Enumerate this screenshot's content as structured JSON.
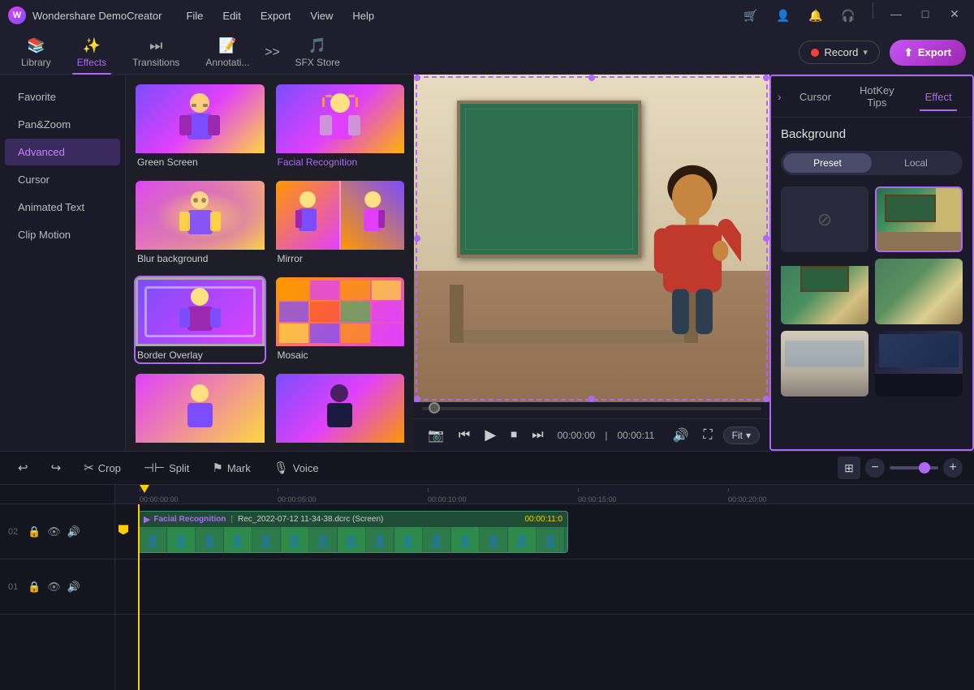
{
  "app": {
    "name": "Wondershare DemoCreator",
    "logo": "W"
  },
  "title_bar": {
    "menu_items": [
      "File",
      "Edit",
      "Export",
      "View",
      "Help"
    ],
    "icons": [
      "cart-icon",
      "user-icon",
      "notification-icon",
      "headset-icon"
    ],
    "win_minimize": "—",
    "win_maximize": "□",
    "win_close": "✕"
  },
  "toolbar": {
    "tabs": [
      {
        "id": "library",
        "label": "Library",
        "icon": "📚"
      },
      {
        "id": "effects",
        "label": "Effects",
        "icon": "✨"
      },
      {
        "id": "transitions",
        "label": "Transitions",
        "icon": "⏭"
      },
      {
        "id": "annotations",
        "label": "Annotati...",
        "icon": "📝"
      },
      {
        "id": "sfx",
        "label": "SFX Store",
        "icon": "🎵"
      }
    ],
    "active_tab": "effects",
    "record_label": "Record",
    "export_label": "Export"
  },
  "sidebar": {
    "items": [
      {
        "id": "favorite",
        "label": "Favorite"
      },
      {
        "id": "panzoom",
        "label": "Pan&Zoom"
      },
      {
        "id": "advanced",
        "label": "Advanced"
      },
      {
        "id": "cursor",
        "label": "Cursor"
      },
      {
        "id": "animated_text",
        "label": "Animated Text"
      },
      {
        "id": "clip_motion",
        "label": "Clip Motion"
      }
    ],
    "active": "advanced"
  },
  "effects": {
    "cards": [
      {
        "id": "green_screen",
        "label": "Green Screen",
        "style": "gc",
        "selected": false
      },
      {
        "id": "facial_recognition",
        "label": "Facial Recognition",
        "style": "fr",
        "selected": true
      },
      {
        "id": "blur_background",
        "label": "Blur background",
        "style": "blur",
        "selected": false
      },
      {
        "id": "mirror",
        "label": "Mirror",
        "style": "mirror",
        "selected": false
      },
      {
        "id": "border_overlay",
        "label": "Border Overlay",
        "style": "border",
        "selected": true
      },
      {
        "id": "mosaic",
        "label": "Mosaic",
        "style": "mosaic",
        "selected": false
      },
      {
        "id": "extra1",
        "label": "",
        "style": "extra1",
        "selected": false
      },
      {
        "id": "extra2",
        "label": "",
        "style": "extra2",
        "selected": false
      }
    ]
  },
  "video": {
    "current_time": "00:00:00",
    "total_time": "00:00:11",
    "fit_label": "Fit"
  },
  "right_panel": {
    "tabs": [
      "Cursor",
      "HotKey Tips",
      "Effect"
    ],
    "active_tab": "Effect",
    "section_title": "Background",
    "preset_btn": "Preset",
    "local_btn": "Local",
    "active_toggle": "Preset",
    "backgrounds": [
      {
        "id": "none",
        "type": "none"
      },
      {
        "id": "classroom1",
        "type": "classroom1"
      },
      {
        "id": "classroom2",
        "type": "classroom2"
      },
      {
        "id": "classroom3",
        "type": "classroom3"
      },
      {
        "id": "office1",
        "type": "office1"
      },
      {
        "id": "office2",
        "type": "office2"
      }
    ]
  },
  "timeline": {
    "toolbar_buttons": [
      {
        "id": "undo",
        "label": "",
        "icon": "↩"
      },
      {
        "id": "redo",
        "label": "",
        "icon": "↪"
      },
      {
        "id": "crop",
        "label": "Crop",
        "icon": "✂"
      },
      {
        "id": "split",
        "label": "Split",
        "icon": "⊣⊢"
      },
      {
        "id": "mark",
        "label": "Mark",
        "icon": "⚑"
      },
      {
        "id": "voice",
        "label": "Voice",
        "icon": "🎙"
      }
    ],
    "zoom_minus": "−",
    "zoom_plus": "+",
    "ruler_marks": [
      "00:00:00:00",
      "00:00:05:00",
      "00:00:10:00",
      "00:00:15:00",
      "00:00:20:00"
    ],
    "tracks": [
      {
        "num": "02",
        "clip": {
          "name": "Facial Recognition",
          "file": "Rec_2022-07-12 11-34-38.dcrc (Screen)",
          "duration": "00:00:11:0"
        }
      },
      {
        "num": "01",
        "clip": null
      }
    ]
  }
}
